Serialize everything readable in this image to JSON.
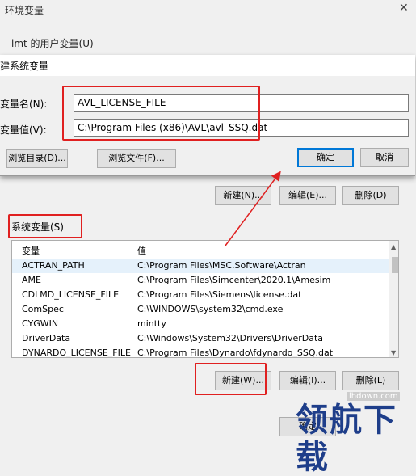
{
  "background_window": {
    "title": "环境变量",
    "close_glyph": "✕",
    "user_vars_label": "lmt 的用户变量(U)",
    "user_buttons": {
      "new": "新建(N)...",
      "edit": "编辑(E)...",
      "delete": "删除(D)"
    }
  },
  "dialog": {
    "title": "建系统变量",
    "name_label": "变量名(N):",
    "name_value": "AVL_LICENSE_FILE",
    "value_label": "变量值(V):",
    "value_value": "C:\\Program Files (x86)\\AVL\\avl_SSQ.dat",
    "buttons": {
      "browse_dir": "浏览目录(D)...",
      "browse_file": "浏览文件(F)...",
      "ok": "确定",
      "cancel": "取消"
    }
  },
  "system_vars": {
    "label": "系统变量(S)",
    "columns": [
      "变量",
      "值"
    ],
    "rows": [
      {
        "name": "ACTRAN_PATH",
        "value": "C:\\Program Files\\MSC.Software\\Actran"
      },
      {
        "name": "AME",
        "value": "C:\\Program Files\\Simcenter\\2020.1\\Amesim"
      },
      {
        "name": "CDLMD_LICENSE_FILE",
        "value": "C:\\Program Files\\Siemens\\license.dat"
      },
      {
        "name": "ComSpec",
        "value": "C:\\WINDOWS\\system32\\cmd.exe"
      },
      {
        "name": "CYGWIN",
        "value": "mintty"
      },
      {
        "name": "DriverData",
        "value": "C:\\Windows\\System32\\Drivers\\DriverData"
      },
      {
        "name": "DYNARDO_LICENSE_FILE",
        "value": "C:\\Program Files\\Dynardo\\fdynardo_SSQ.dat"
      }
    ],
    "buttons": {
      "new": "新建(W)...",
      "edit": "编辑(I)...",
      "delete": "删除(L)"
    },
    "bottom_partial": "确定"
  },
  "branding": {
    "text": "领航下载",
    "url": "lhdown.com"
  },
  "colors": {
    "highlight_box": "#e02020",
    "brand": "#1e3e8a",
    "selection": "#e5f1fb"
  }
}
